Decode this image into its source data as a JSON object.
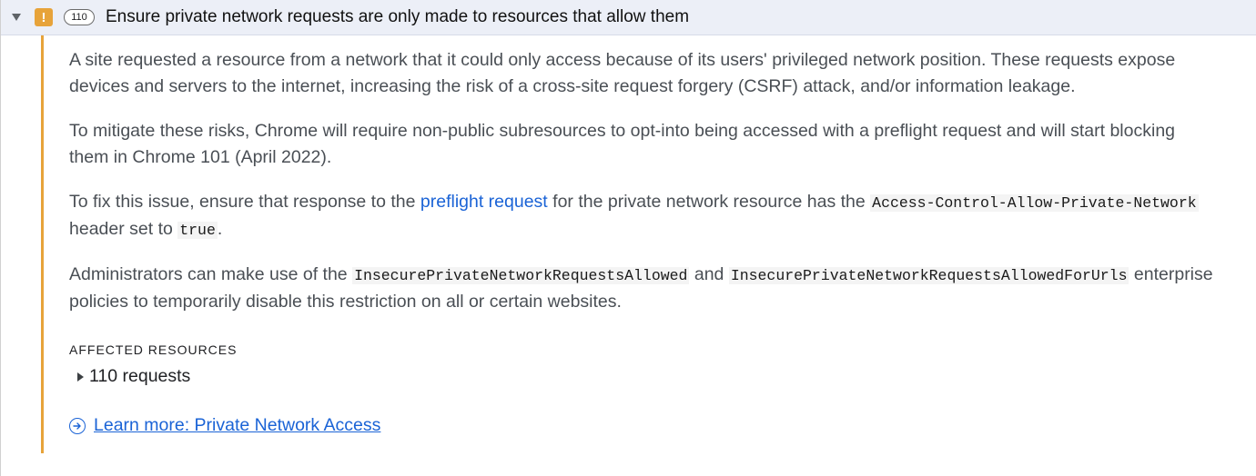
{
  "issue": {
    "count": "110",
    "title": "Ensure private network requests are only made to resources that allow them"
  },
  "paragraphs": {
    "p1_line1": "A site requested a resource from a network that it could only access because of its users' privileged network position. These requests expose",
    "p1_line2": "devices and servers to the internet, increasing the risk of a cross-site request forgery (CSRF) attack, and/or information leakage.",
    "p2_line1": "To mitigate these risks, Chrome will require non-public subresources to opt-into being accessed with a preflight request and will start blocking",
    "p2_line2": "them in Chrome 101 (April 2022).",
    "p3_pre": "To fix this issue, ensure that response to the ",
    "p3_link": "preflight request",
    "p3_mid": " for the private network resource has the ",
    "p3_code": "Access-Control-Allow-Private-Network",
    "p3_line2_pre": "header set to ",
    "p3_code2": "true",
    "p3_end": ".",
    "p4_pre": "Administrators can make use of the ",
    "p4_code1": "InsecurePrivateNetworkRequestsAllowed",
    "p4_and": " and ",
    "p4_code2": "InsecurePrivateNetworkRequestsAllowedForUrls",
    "p4_post": " enterprise",
    "p4_line2": "policies to temporarily disable this restriction on all or certain websites."
  },
  "affected": {
    "label": "AFFECTED RESOURCES",
    "requests": "110 requests"
  },
  "learn_more": {
    "label": "Learn more: Private Network Access"
  },
  "icons": {
    "warning": "warning-icon",
    "learn": "circle-arrow-right-icon"
  },
  "colors": {
    "warning": "#e7a33a",
    "link": "#1a63d6",
    "header_bg": "#eceff7"
  }
}
